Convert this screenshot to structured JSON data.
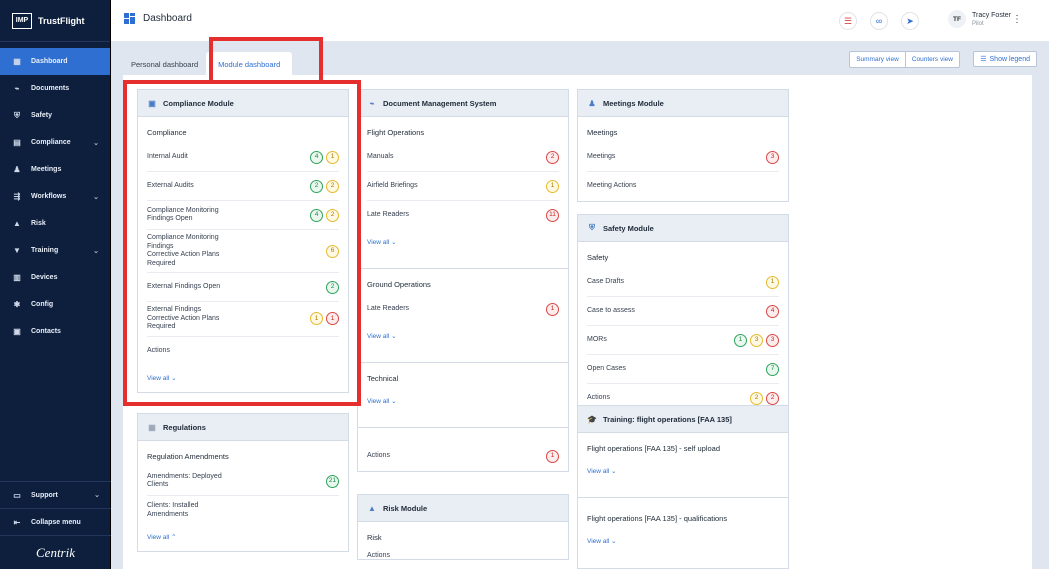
{
  "brand": {
    "logo": "IMP",
    "name": "TrustFlight"
  },
  "sidebar": {
    "items": [
      {
        "label": "Dashboard",
        "icon": "dashboard-icon",
        "active": true,
        "chevron": false
      },
      {
        "label": "Documents",
        "icon": "paperclip-icon",
        "chevron": false
      },
      {
        "label": "Safety",
        "icon": "shield-icon",
        "chevron": false
      },
      {
        "label": "Compliance",
        "icon": "document-icon",
        "chevron": true
      },
      {
        "label": "Meetings",
        "icon": "meetings-icon",
        "chevron": false
      },
      {
        "label": "Workflows",
        "icon": "workflow-icon",
        "chevron": true
      },
      {
        "label": "Risk",
        "icon": "warning-icon",
        "chevron": false
      },
      {
        "label": "Training",
        "icon": "graduation-cap-icon",
        "chevron": true
      },
      {
        "label": "Devices",
        "icon": "devices-icon",
        "chevron": false
      },
      {
        "label": "Config",
        "icon": "config-icon",
        "chevron": false
      },
      {
        "label": "Contacts",
        "icon": "contacts-icon",
        "chevron": false
      }
    ],
    "support_label": "Support",
    "collapse_label": "Collapse menu",
    "footer_logo": "Centrik"
  },
  "header": {
    "title": "Dashboard",
    "user_initials": "TF",
    "user_name": "Tracy Foster",
    "user_role": "Pilot"
  },
  "tabs": {
    "personal": "Personal dashboard",
    "module": "Module dashboard"
  },
  "toolbar": {
    "summary_view": "Summary view",
    "counters_view": "Counters view",
    "show_legend": "Show legend"
  },
  "view_all": "View all",
  "colors": {
    "sidebar_bg": "#0d1f3c",
    "accent": "#2e6fd1",
    "highlight": "#e52e2e",
    "green": "#2da55c",
    "yellow": "#e6b92c",
    "red": "#d94747"
  },
  "compliance": {
    "title": "Compliance Module",
    "section": "Compliance",
    "rows": [
      {
        "label": "Internal Audit",
        "badges": [
          [
            "g",
            "4"
          ],
          [
            "y",
            "1"
          ]
        ]
      },
      {
        "label": "External Audits",
        "badges": [
          [
            "g",
            "2"
          ],
          [
            "y",
            "2"
          ]
        ]
      },
      {
        "label": "Compliance Monitoring\nFindings Open",
        "badges": [
          [
            "g",
            "4"
          ],
          [
            "y",
            "2"
          ]
        ]
      },
      {
        "label": "Compliance Monitoring\nFindings\nCorrective Action Plans\nRequired",
        "badges": [
          [
            "y",
            "6"
          ]
        ]
      },
      {
        "label": "External Findings Open",
        "badges": [
          [
            "g",
            "2"
          ]
        ]
      },
      {
        "label": "External Findings\nCorrective Action Plans\nRequired",
        "badges": [
          [
            "y",
            "1"
          ],
          [
            "r",
            "1"
          ]
        ]
      },
      {
        "label": "Actions",
        "badges": []
      }
    ]
  },
  "regulations": {
    "title": "Regulations",
    "section": "Regulation Amendments",
    "rows": [
      {
        "label": "Amendments: Deployed\nClients",
        "badges": [
          [
            "g",
            "21"
          ]
        ]
      },
      {
        "label": "Clients: Installed\nAmendments",
        "badges": []
      }
    ]
  },
  "dms": {
    "title": "Document Management System",
    "flight_ops": {
      "section": "Flight Operations",
      "rows": [
        {
          "label": "Manuals",
          "badges": [
            [
              "r",
              "2"
            ]
          ]
        },
        {
          "label": "Airfield Briefings",
          "badges": [
            [
              "y",
              "1"
            ]
          ]
        },
        {
          "label": "Late Readers",
          "badges": [
            [
              "r",
              "11"
            ]
          ]
        }
      ]
    },
    "ground_ops": {
      "section": "Ground Operations",
      "rows": [
        {
          "label": "Late Readers",
          "badges": [
            [
              "r",
              "1"
            ]
          ]
        }
      ]
    },
    "technical": {
      "section": "Technical"
    },
    "actions": {
      "label": "Actions",
      "badges": [
        [
          "r",
          "1"
        ]
      ]
    }
  },
  "risk": {
    "title": "Risk Module",
    "section": "Risk",
    "actions": "Actions"
  },
  "meetings": {
    "title": "Meetings Module",
    "section": "Meetings",
    "rows": [
      {
        "label": "Meetings",
        "badges": [
          [
            "r",
            "3"
          ]
        ]
      },
      {
        "label": "Meeting Actions",
        "badges": []
      }
    ]
  },
  "safety": {
    "title": "Safety Module",
    "section": "Safety",
    "rows": [
      {
        "label": "Case Drafts",
        "badges": [
          [
            "y",
            "1"
          ]
        ]
      },
      {
        "label": "Case to assess",
        "badges": [
          [
            "r",
            "4"
          ]
        ]
      },
      {
        "label": "MORs",
        "badges": [
          [
            "g",
            "1"
          ],
          [
            "y",
            "3"
          ],
          [
            "r",
            "3"
          ]
        ]
      },
      {
        "label": "Open Cases",
        "badges": [
          [
            "g",
            "7"
          ]
        ]
      },
      {
        "label": "Actions",
        "badges": [
          [
            "y",
            "2"
          ],
          [
            "r",
            "2"
          ]
        ]
      }
    ]
  },
  "training": {
    "title": "Training: flight operations [FAA 135]",
    "sections": [
      "Flight operations [FAA 135] - self upload",
      "Flight operations [FAA 135] - qualifications"
    ]
  }
}
